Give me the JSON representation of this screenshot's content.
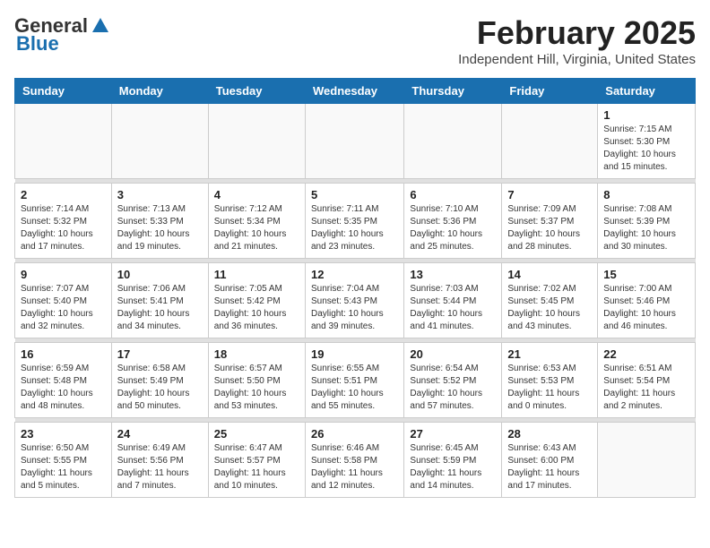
{
  "header": {
    "logo_general": "General",
    "logo_blue": "Blue",
    "title": "February 2025",
    "subtitle": "Independent Hill, Virginia, United States"
  },
  "weekdays": [
    "Sunday",
    "Monday",
    "Tuesday",
    "Wednesday",
    "Thursday",
    "Friday",
    "Saturday"
  ],
  "weeks": [
    [
      {
        "day": "",
        "info": ""
      },
      {
        "day": "",
        "info": ""
      },
      {
        "day": "",
        "info": ""
      },
      {
        "day": "",
        "info": ""
      },
      {
        "day": "",
        "info": ""
      },
      {
        "day": "",
        "info": ""
      },
      {
        "day": "1",
        "info": "Sunrise: 7:15 AM\nSunset: 5:30 PM\nDaylight: 10 hours and 15 minutes."
      }
    ],
    [
      {
        "day": "2",
        "info": "Sunrise: 7:14 AM\nSunset: 5:32 PM\nDaylight: 10 hours and 17 minutes."
      },
      {
        "day": "3",
        "info": "Sunrise: 7:13 AM\nSunset: 5:33 PM\nDaylight: 10 hours and 19 minutes."
      },
      {
        "day": "4",
        "info": "Sunrise: 7:12 AM\nSunset: 5:34 PM\nDaylight: 10 hours and 21 minutes."
      },
      {
        "day": "5",
        "info": "Sunrise: 7:11 AM\nSunset: 5:35 PM\nDaylight: 10 hours and 23 minutes."
      },
      {
        "day": "6",
        "info": "Sunrise: 7:10 AM\nSunset: 5:36 PM\nDaylight: 10 hours and 25 minutes."
      },
      {
        "day": "7",
        "info": "Sunrise: 7:09 AM\nSunset: 5:37 PM\nDaylight: 10 hours and 28 minutes."
      },
      {
        "day": "8",
        "info": "Sunrise: 7:08 AM\nSunset: 5:39 PM\nDaylight: 10 hours and 30 minutes."
      }
    ],
    [
      {
        "day": "9",
        "info": "Sunrise: 7:07 AM\nSunset: 5:40 PM\nDaylight: 10 hours and 32 minutes."
      },
      {
        "day": "10",
        "info": "Sunrise: 7:06 AM\nSunset: 5:41 PM\nDaylight: 10 hours and 34 minutes."
      },
      {
        "day": "11",
        "info": "Sunrise: 7:05 AM\nSunset: 5:42 PM\nDaylight: 10 hours and 36 minutes."
      },
      {
        "day": "12",
        "info": "Sunrise: 7:04 AM\nSunset: 5:43 PM\nDaylight: 10 hours and 39 minutes."
      },
      {
        "day": "13",
        "info": "Sunrise: 7:03 AM\nSunset: 5:44 PM\nDaylight: 10 hours and 41 minutes."
      },
      {
        "day": "14",
        "info": "Sunrise: 7:02 AM\nSunset: 5:45 PM\nDaylight: 10 hours and 43 minutes."
      },
      {
        "day": "15",
        "info": "Sunrise: 7:00 AM\nSunset: 5:46 PM\nDaylight: 10 hours and 46 minutes."
      }
    ],
    [
      {
        "day": "16",
        "info": "Sunrise: 6:59 AM\nSunset: 5:48 PM\nDaylight: 10 hours and 48 minutes."
      },
      {
        "day": "17",
        "info": "Sunrise: 6:58 AM\nSunset: 5:49 PM\nDaylight: 10 hours and 50 minutes."
      },
      {
        "day": "18",
        "info": "Sunrise: 6:57 AM\nSunset: 5:50 PM\nDaylight: 10 hours and 53 minutes."
      },
      {
        "day": "19",
        "info": "Sunrise: 6:55 AM\nSunset: 5:51 PM\nDaylight: 10 hours and 55 minutes."
      },
      {
        "day": "20",
        "info": "Sunrise: 6:54 AM\nSunset: 5:52 PM\nDaylight: 10 hours and 57 minutes."
      },
      {
        "day": "21",
        "info": "Sunrise: 6:53 AM\nSunset: 5:53 PM\nDaylight: 11 hours and 0 minutes."
      },
      {
        "day": "22",
        "info": "Sunrise: 6:51 AM\nSunset: 5:54 PM\nDaylight: 11 hours and 2 minutes."
      }
    ],
    [
      {
        "day": "23",
        "info": "Sunrise: 6:50 AM\nSunset: 5:55 PM\nDaylight: 11 hours and 5 minutes."
      },
      {
        "day": "24",
        "info": "Sunrise: 6:49 AM\nSunset: 5:56 PM\nDaylight: 11 hours and 7 minutes."
      },
      {
        "day": "25",
        "info": "Sunrise: 6:47 AM\nSunset: 5:57 PM\nDaylight: 11 hours and 10 minutes."
      },
      {
        "day": "26",
        "info": "Sunrise: 6:46 AM\nSunset: 5:58 PM\nDaylight: 11 hours and 12 minutes."
      },
      {
        "day": "27",
        "info": "Sunrise: 6:45 AM\nSunset: 5:59 PM\nDaylight: 11 hours and 14 minutes."
      },
      {
        "day": "28",
        "info": "Sunrise: 6:43 AM\nSunset: 6:00 PM\nDaylight: 11 hours and 17 minutes."
      },
      {
        "day": "",
        "info": ""
      }
    ]
  ]
}
